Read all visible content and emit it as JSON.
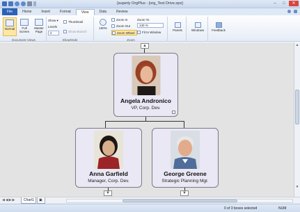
{
  "window": {
    "title": "[superly OrgPlus - [org_Test Drive.opx]"
  },
  "tabs": [
    {
      "label": "File"
    },
    {
      "label": "Home"
    },
    {
      "label": "Insert"
    },
    {
      "label": "Format"
    },
    {
      "label": "View"
    },
    {
      "label": "Data"
    },
    {
      "label": "Review"
    }
  ],
  "ribbon": {
    "document_views": {
      "label": "Document Views",
      "normal": "Normal",
      "full_screen": "Full Screen",
      "master_page": "Master Page"
    },
    "show_hide": {
      "label": "Show/Hide",
      "show": "Show",
      "levels": "Levels",
      "levels_value": "2",
      "thumbnail": "Thumbnail",
      "show_branch": "Show Branch"
    },
    "zoom": {
      "label": "Zoom",
      "zoom_pct": "100%",
      "zoom_in": "Zoom In",
      "zoom_out": "Zoom Out",
      "zoom_wheel": "Zoom Wheel",
      "zoom_to": "Zoom To",
      "zoom_to_value": "140 %",
      "fit_to_window": "Fit to Window"
    },
    "panels": "Panels",
    "windows": "Windows",
    "feedback": "Feedback"
  },
  "chart": {
    "root": {
      "name": "Angela Andronico",
      "title": "VP, Corp. Dev."
    },
    "children": [
      {
        "name": "Anna Garfield",
        "title": "Manager, Corp. Dev."
      },
      {
        "name": "George Greene",
        "title": "Strategic Planning Mgr."
      }
    ]
  },
  "bottom": {
    "sheet_tab": "Chart1"
  },
  "status": {
    "selection": "0 of 3 boxes selected",
    "num": "NUM"
  }
}
